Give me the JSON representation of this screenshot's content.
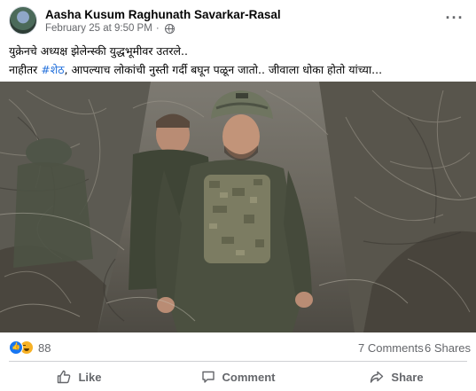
{
  "post": {
    "author": "Aasha Kusum Raghunath Savarkar-Rasal",
    "timestamp": "February 25 at 9:50 PM",
    "separator": "·",
    "audience_icon": "globe-icon",
    "menu_label": "···",
    "caption_line1": "युक्रेनचे अध्यक्ष झेलेन्स्की युद्धभूमीवर उतरले..",
    "caption_line2_before": "नाहीतर ",
    "caption_hashtag": "#शेठ",
    "caption_line2_after": ", आपल्याच लोकांची नुस्ती गर्दी बघून पळून जातो.. जीवाला धोका होतो यांच्या..."
  },
  "stats": {
    "reaction_icons": [
      "like-icon",
      "haha-icon"
    ],
    "reaction_count": "88",
    "comments": "7 Comments",
    "shares": "6 Shares"
  },
  "actions": {
    "like": "Like",
    "comment": "Comment",
    "share": "Share"
  },
  "colors": {
    "accent": "#1877f2",
    "hashtag": "#216fdb",
    "secondary_text": "#65676b",
    "divider": "#ced0d4"
  }
}
